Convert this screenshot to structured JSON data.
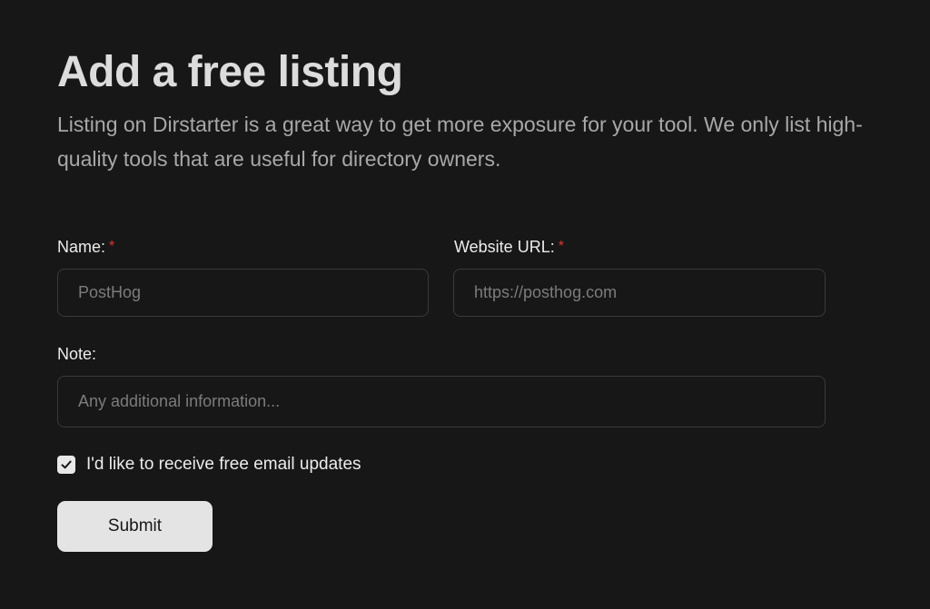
{
  "header": {
    "title": "Add a free listing",
    "subtitle": "Listing on Dirstarter is a great way to get more exposure for your tool. We only list high-quality tools that are useful for directory owners."
  },
  "form": {
    "name": {
      "label": "Name:",
      "required_mark": "*",
      "placeholder": "PostHog",
      "value": ""
    },
    "website": {
      "label": "Website URL:",
      "required_mark": "*",
      "placeholder": "https://posthog.com",
      "value": ""
    },
    "note": {
      "label": "Note:",
      "placeholder": "Any additional information...",
      "value": ""
    },
    "newsletter": {
      "label": "I'd like to receive free email updates",
      "checked": true,
      "icon": "checkmark-icon"
    },
    "submit_label": "Submit"
  },
  "colors": {
    "background": "#171717",
    "input_border": "#3a3a3a",
    "required": "#e0362e",
    "button_bg": "#e4e4e4"
  }
}
